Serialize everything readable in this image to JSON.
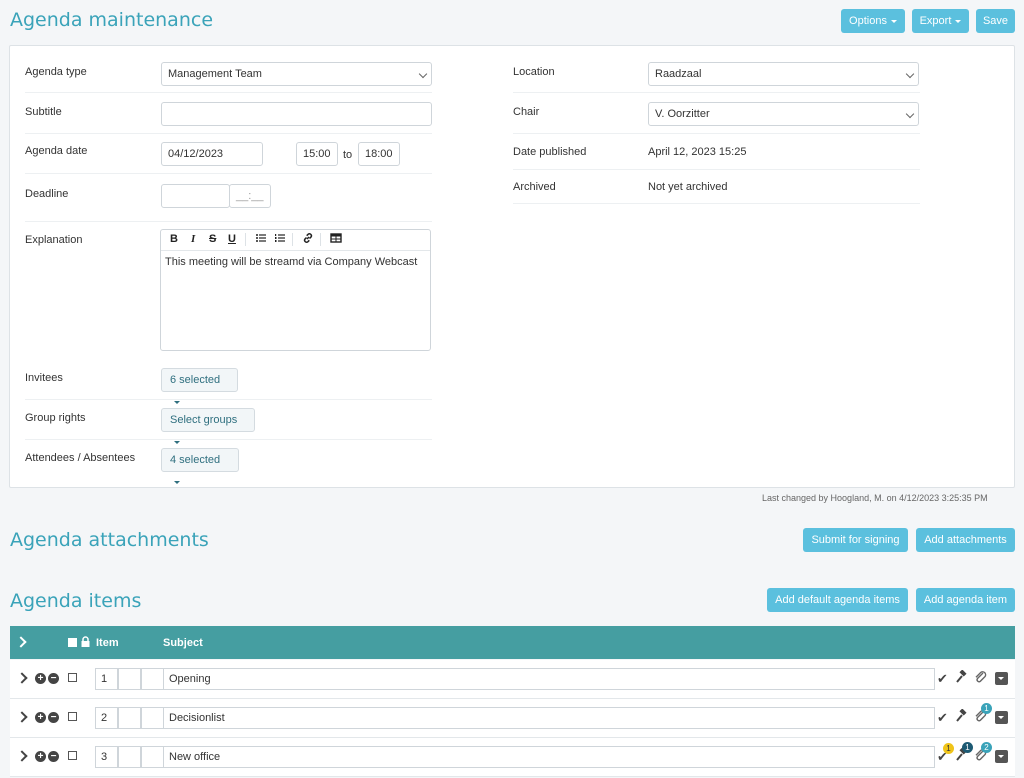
{
  "page": {
    "title": "Agenda maintenance",
    "buttons": {
      "options": "Options",
      "export": "Export",
      "save": "Save"
    }
  },
  "form": {
    "agenda_type": {
      "label": "Agenda type",
      "value": "Management Team"
    },
    "subtitle": {
      "label": "Subtitle",
      "value": ""
    },
    "agenda_date": {
      "label": "Agenda date",
      "value": "04/12/2023",
      "start": "15:00",
      "to": "to",
      "end": "18:00"
    },
    "deadline": {
      "label": "Deadline",
      "date": "",
      "time_placeholder": "__:__"
    },
    "explanation": {
      "label": "Explanation",
      "text": "This meeting will be streamd via Company Webcast"
    },
    "invitees": {
      "label": "Invitees",
      "value": "6 selected"
    },
    "group_rights": {
      "label": "Group rights",
      "value": "Select groups"
    },
    "attendees": {
      "label": "Attendees / Absentees",
      "value": "4 selected"
    },
    "location": {
      "label": "Location",
      "value": "Raadzaal"
    },
    "chair": {
      "label": "Chair",
      "value": "V. Oorzitter"
    },
    "date_published": {
      "label": "Date published",
      "value": "April 12, 2023 15:25"
    },
    "archived": {
      "label": "Archived",
      "value": "Not yet archived"
    }
  },
  "editor_toolbar": {
    "bold": "B",
    "italic": "I",
    "strike": "S",
    "underline": "U"
  },
  "last_changed": "Last changed by Hoogland, M. on 4/12/2023 3:25:35 PM",
  "attachments": {
    "title": "Agenda attachments",
    "submit": "Submit for signing",
    "add": "Add attachments"
  },
  "items": {
    "title": "Agenda items",
    "add_default": "Add default agenda items",
    "add": "Add agenda item",
    "columns": {
      "item": "Item",
      "subject": "Subject"
    },
    "rows": [
      {
        "number": "1",
        "subject": "Opening",
        "badges": {
          "check": "",
          "hammer": "",
          "clip": ""
        }
      },
      {
        "number": "2",
        "subject": "Decisionlist",
        "badges": {
          "check": "",
          "hammer": "",
          "clip": "1"
        }
      },
      {
        "number": "3",
        "subject": "New office",
        "badges": {
          "check": "1",
          "hammer": "1",
          "clip": "2"
        }
      }
    ]
  },
  "colors": {
    "accent": "#3aa3b9",
    "button": "#5bc0de",
    "table_header": "#459ea1",
    "badge_yellow": "#f0c419",
    "badge_blue": "#1d5a73",
    "badge_teal": "#3aa3b9"
  }
}
